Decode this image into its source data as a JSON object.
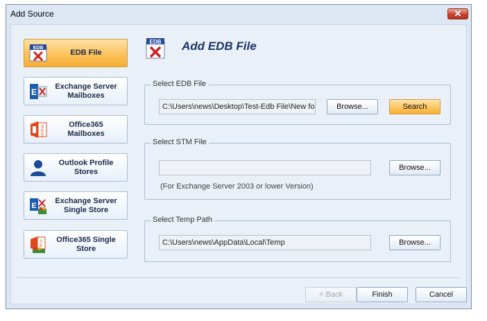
{
  "window": {
    "title": "Add Source",
    "close_label": "✕"
  },
  "sources": [
    {
      "label": "EDB File",
      "icon": "edb-file-icon",
      "active": true
    },
    {
      "label": "Exchange Server\nMailboxes",
      "icon": "exchange-server-icon",
      "active": false
    },
    {
      "label": "Office365\nMailboxes",
      "icon": "office365-icon",
      "active": false
    },
    {
      "label": "Outlook Profile\nStores",
      "icon": "outlook-profile-icon",
      "active": false
    },
    {
      "label": "Exchange Server\nSingle Store",
      "icon": "exchange-single-store-icon",
      "active": false
    },
    {
      "label": "Office365 Single\nStore",
      "icon": "office365-single-store-icon",
      "active": false
    }
  ],
  "main": {
    "heading": "Add EDB File",
    "edb_group": {
      "title": "Select EDB File",
      "path": "C:\\Users\\news\\Desktop\\Test-Edb File\\New fo",
      "browse_label": "Browse...",
      "search_label": "Search"
    },
    "stm_group": {
      "title": "Select STM File",
      "path": "",
      "browse_label": "Browse...",
      "hint": "(For Exchange Server 2003 or lower Version)"
    },
    "temp_group": {
      "title": "Select Temp Path",
      "path": "C:\\Users\\news\\AppData\\Local\\Temp",
      "browse_label": "Browse..."
    }
  },
  "footer": {
    "back_label": "< Back",
    "finish_label": "Finish",
    "cancel_label": "Cancel"
  },
  "colors": {
    "accent": "#fbc25c",
    "window_bg": "#dce7f3",
    "heading": "#1a3568"
  }
}
